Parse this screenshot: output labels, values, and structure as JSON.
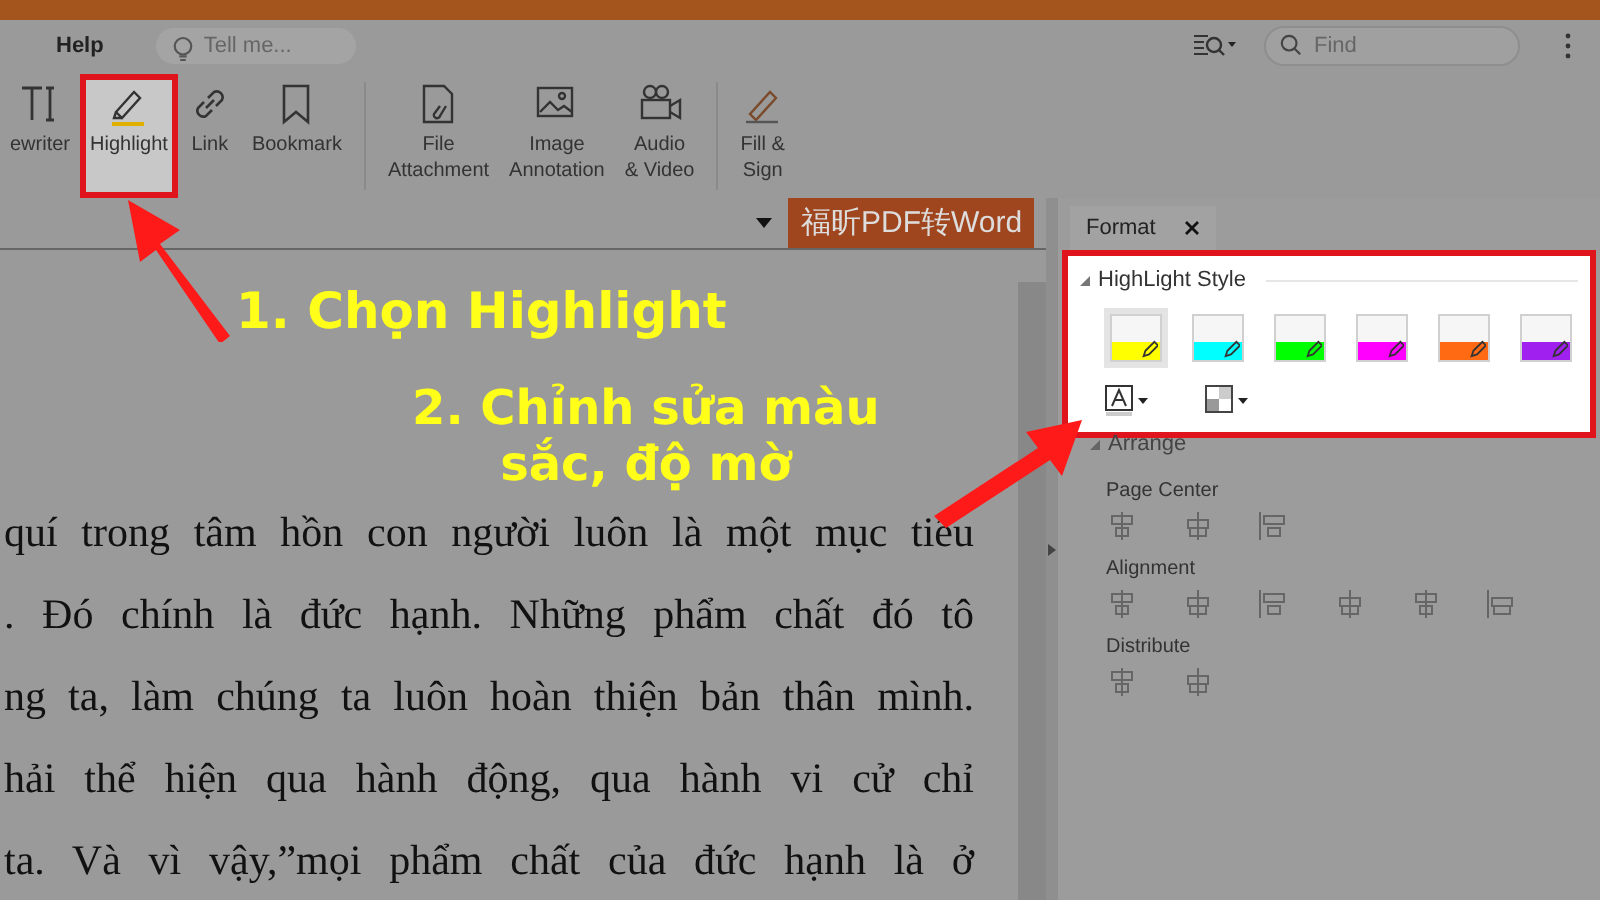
{
  "menu": {
    "items": [
      {
        "label": "Help"
      }
    ],
    "tell_me": {
      "placeholder": "Tell me..."
    },
    "find": {
      "placeholder": "Find"
    }
  },
  "ribbon": {
    "groups": [
      {
        "tools": [
          {
            "label": [
              "ewriter"
            ],
            "selected": false
          },
          {
            "label": [
              "Highlight"
            ],
            "selected": true
          },
          {
            "label": [
              "Link"
            ],
            "selected": false
          },
          {
            "label": [
              "Bookmark"
            ],
            "selected": false
          }
        ]
      },
      {
        "tools": [
          {
            "label": [
              "File",
              "Attachment"
            ],
            "selected": false
          },
          {
            "label": [
              "Image",
              "Annotation"
            ],
            "selected": false
          },
          {
            "label": [
              "Audio",
              "& Video"
            ],
            "selected": false
          }
        ]
      },
      {
        "tools": [
          {
            "label": [
              "Fill &",
              "Sign"
            ],
            "selected": false
          }
        ]
      }
    ]
  },
  "convert_button": "福昕PDF转Word",
  "document": {
    "lines": [
      "quí trong tâm hồn con người luôn là một mục tiêu",
      ". Đó chính là đức hạnh. Những phẩm chất đó tô",
      "ng ta, làm chúng ta luôn hoàn thiện bản thân mình.",
      "hải thể hiện qua hành động, qua hành vi cử chỉ",
      "ta. Và vì vậy,”mọi phẩm chất của đức hạnh là ở"
    ]
  },
  "panel": {
    "tab": "Format",
    "highlight_style": {
      "title": "HighLight Style",
      "swatches": [
        {
          "color": "#ffff00",
          "selected": true
        },
        {
          "color": "#00ffff",
          "selected": false
        },
        {
          "color": "#00ff00",
          "selected": false
        },
        {
          "color": "#ff00ff",
          "selected": false
        },
        {
          "color": "#ff6a13",
          "selected": false
        },
        {
          "color": "#a020f0",
          "selected": false
        }
      ]
    },
    "arrange": {
      "title": "Arrange",
      "sections": [
        "Page Center",
        "Alignment",
        "Distribute"
      ]
    }
  },
  "callouts": [
    {
      "lines": [
        "1. Chọn Highlight"
      ]
    },
    {
      "lines": [
        "2. Chỉnh sửa màu",
        "sắc, độ mờ"
      ]
    }
  ]
}
